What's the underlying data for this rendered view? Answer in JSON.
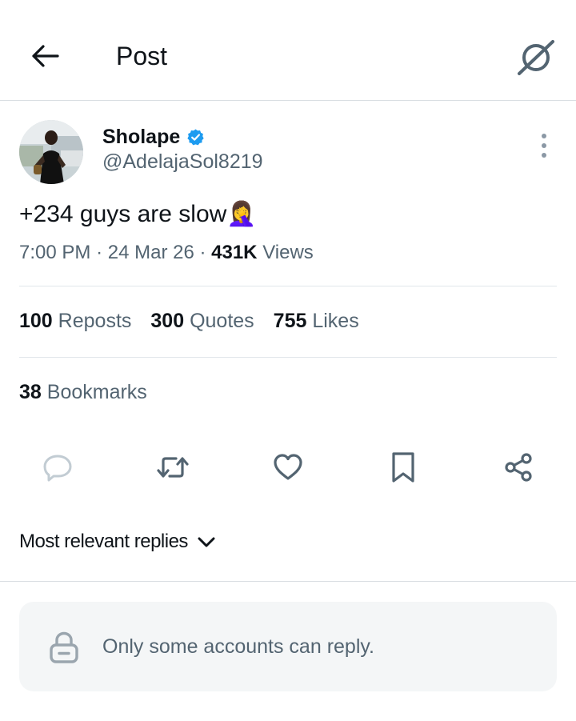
{
  "header": {
    "title": "Post"
  },
  "post": {
    "author_name": "Sholape",
    "handle": "@AdelajaSol8219",
    "text": "+234 guys are slow🤦‍♀️",
    "time": "7:00 PM",
    "date": "24 Mar 26",
    "views_count": "431K",
    "views_label": "Views",
    "separator": "·"
  },
  "stats": {
    "reposts_count": "100",
    "reposts_label": "Reposts",
    "quotes_count": "300",
    "quotes_label": "Quotes",
    "likes_count": "755",
    "likes_label": "Likes",
    "bookmarks_count": "38",
    "bookmarks_label": "Bookmarks"
  },
  "replies": {
    "sort_label": "Most relevant replies",
    "restriction_text": "Only some accounts can reply."
  },
  "colors": {
    "text_primary": "#0f1419",
    "text_secondary": "#536471",
    "verified_blue": "#1d9bf0",
    "icon_gray": "#536471",
    "reply_box_bg": "#f4f6f7"
  },
  "icons": {
    "back": "arrow-left-icon",
    "grok": "grok-icon",
    "verified": "verified-badge-icon",
    "more": "more-vertical-icon",
    "reply": "reply-icon",
    "repost": "repost-icon",
    "like": "heart-icon",
    "bookmark": "bookmark-icon",
    "share": "share-icon",
    "sort": "chevron-down-icon",
    "lock": "lock-icon"
  }
}
